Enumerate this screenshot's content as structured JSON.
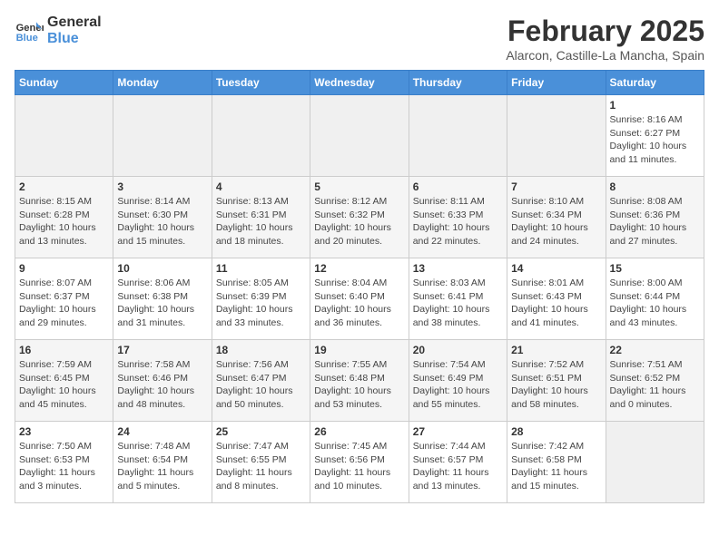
{
  "logo": {
    "line1": "General",
    "line2": "Blue"
  },
  "title": {
    "month_year": "February 2025",
    "location": "Alarcon, Castille-La Mancha, Spain"
  },
  "days_of_week": [
    "Sunday",
    "Monday",
    "Tuesday",
    "Wednesday",
    "Thursday",
    "Friday",
    "Saturday"
  ],
  "weeks": [
    [
      {
        "day": "",
        "info": ""
      },
      {
        "day": "",
        "info": ""
      },
      {
        "day": "",
        "info": ""
      },
      {
        "day": "",
        "info": ""
      },
      {
        "day": "",
        "info": ""
      },
      {
        "day": "",
        "info": ""
      },
      {
        "day": "1",
        "info": "Sunrise: 8:16 AM\nSunset: 6:27 PM\nDaylight: 10 hours\nand 11 minutes."
      }
    ],
    [
      {
        "day": "2",
        "info": "Sunrise: 8:15 AM\nSunset: 6:28 PM\nDaylight: 10 hours\nand 13 minutes."
      },
      {
        "day": "3",
        "info": "Sunrise: 8:14 AM\nSunset: 6:30 PM\nDaylight: 10 hours\nand 15 minutes."
      },
      {
        "day": "4",
        "info": "Sunrise: 8:13 AM\nSunset: 6:31 PM\nDaylight: 10 hours\nand 18 minutes."
      },
      {
        "day": "5",
        "info": "Sunrise: 8:12 AM\nSunset: 6:32 PM\nDaylight: 10 hours\nand 20 minutes."
      },
      {
        "day": "6",
        "info": "Sunrise: 8:11 AM\nSunset: 6:33 PM\nDaylight: 10 hours\nand 22 minutes."
      },
      {
        "day": "7",
        "info": "Sunrise: 8:10 AM\nSunset: 6:34 PM\nDaylight: 10 hours\nand 24 minutes."
      },
      {
        "day": "8",
        "info": "Sunrise: 8:08 AM\nSunset: 6:36 PM\nDaylight: 10 hours\nand 27 minutes."
      }
    ],
    [
      {
        "day": "9",
        "info": "Sunrise: 8:07 AM\nSunset: 6:37 PM\nDaylight: 10 hours\nand 29 minutes."
      },
      {
        "day": "10",
        "info": "Sunrise: 8:06 AM\nSunset: 6:38 PM\nDaylight: 10 hours\nand 31 minutes."
      },
      {
        "day": "11",
        "info": "Sunrise: 8:05 AM\nSunset: 6:39 PM\nDaylight: 10 hours\nand 33 minutes."
      },
      {
        "day": "12",
        "info": "Sunrise: 8:04 AM\nSunset: 6:40 PM\nDaylight: 10 hours\nand 36 minutes."
      },
      {
        "day": "13",
        "info": "Sunrise: 8:03 AM\nSunset: 6:41 PM\nDaylight: 10 hours\nand 38 minutes."
      },
      {
        "day": "14",
        "info": "Sunrise: 8:01 AM\nSunset: 6:43 PM\nDaylight: 10 hours\nand 41 minutes."
      },
      {
        "day": "15",
        "info": "Sunrise: 8:00 AM\nSunset: 6:44 PM\nDaylight: 10 hours\nand 43 minutes."
      }
    ],
    [
      {
        "day": "16",
        "info": "Sunrise: 7:59 AM\nSunset: 6:45 PM\nDaylight: 10 hours\nand 45 minutes."
      },
      {
        "day": "17",
        "info": "Sunrise: 7:58 AM\nSunset: 6:46 PM\nDaylight: 10 hours\nand 48 minutes."
      },
      {
        "day": "18",
        "info": "Sunrise: 7:56 AM\nSunset: 6:47 PM\nDaylight: 10 hours\nand 50 minutes."
      },
      {
        "day": "19",
        "info": "Sunrise: 7:55 AM\nSunset: 6:48 PM\nDaylight: 10 hours\nand 53 minutes."
      },
      {
        "day": "20",
        "info": "Sunrise: 7:54 AM\nSunset: 6:49 PM\nDaylight: 10 hours\nand 55 minutes."
      },
      {
        "day": "21",
        "info": "Sunrise: 7:52 AM\nSunset: 6:51 PM\nDaylight: 10 hours\nand 58 minutes."
      },
      {
        "day": "22",
        "info": "Sunrise: 7:51 AM\nSunset: 6:52 PM\nDaylight: 11 hours\nand 0 minutes."
      }
    ],
    [
      {
        "day": "23",
        "info": "Sunrise: 7:50 AM\nSunset: 6:53 PM\nDaylight: 11 hours\nand 3 minutes."
      },
      {
        "day": "24",
        "info": "Sunrise: 7:48 AM\nSunset: 6:54 PM\nDaylight: 11 hours\nand 5 minutes."
      },
      {
        "day": "25",
        "info": "Sunrise: 7:47 AM\nSunset: 6:55 PM\nDaylight: 11 hours\nand 8 minutes."
      },
      {
        "day": "26",
        "info": "Sunrise: 7:45 AM\nSunset: 6:56 PM\nDaylight: 11 hours\nand 10 minutes."
      },
      {
        "day": "27",
        "info": "Sunrise: 7:44 AM\nSunset: 6:57 PM\nDaylight: 11 hours\nand 13 minutes."
      },
      {
        "day": "28",
        "info": "Sunrise: 7:42 AM\nSunset: 6:58 PM\nDaylight: 11 hours\nand 15 minutes."
      },
      {
        "day": "",
        "info": ""
      }
    ]
  ]
}
